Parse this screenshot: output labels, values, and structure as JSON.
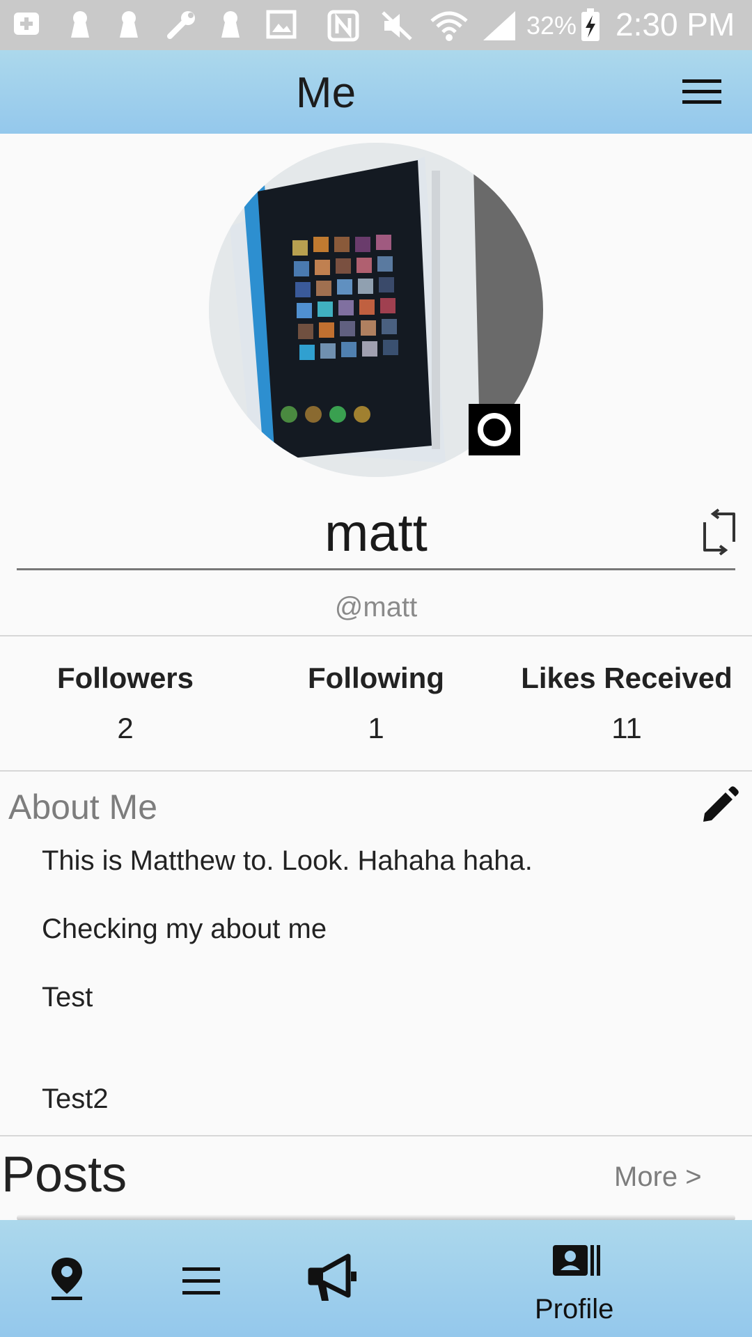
{
  "status_bar": {
    "battery": "32%",
    "time": "2:30 PM"
  },
  "app_bar": {
    "title": "Me"
  },
  "profile": {
    "display_name": "matt",
    "handle": "@matt"
  },
  "stats": [
    {
      "label": "Followers",
      "value": "2"
    },
    {
      "label": "Following",
      "value": "1"
    },
    {
      "label": "Likes Received",
      "value": "11"
    }
  ],
  "about": {
    "title": "About Me",
    "lines": [
      "This is Matthew to. Look. Hahaha haha.",
      "Checking my about me",
      "Test",
      "Test2"
    ]
  },
  "posts": {
    "title": "Posts",
    "more_label": "More >"
  },
  "bottom_nav": {
    "profile_label": "Profile"
  },
  "colors": {
    "bar_top": "#acd8ec",
    "bar_bottom": "#94c8ec",
    "status_bar": "#c9c9c9",
    "background": "#fafafa"
  }
}
